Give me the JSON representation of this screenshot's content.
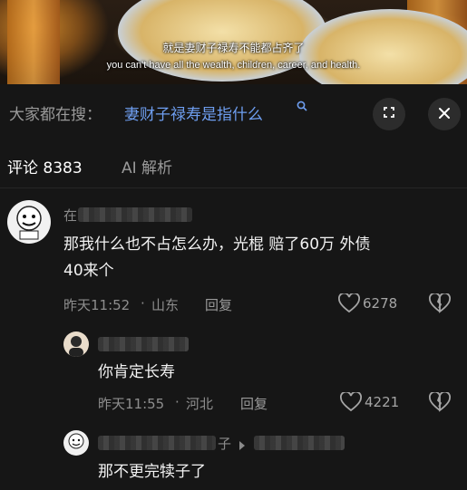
{
  "video": {
    "subtitle_zh": "就是妻财子禄寿不能都占齐了",
    "subtitle_en": "you can't have all the wealth, children, career, and health."
  },
  "search": {
    "prefix": "大家都在搜：",
    "query": "妻财子禄寿是指什么",
    "icon": "search-icon"
  },
  "actions": {
    "expand_icon": "expand-icon",
    "close_icon": "close-icon"
  },
  "tabs": [
    {
      "label": "评论 8383",
      "active": true
    },
    {
      "label": "AI 解析",
      "active": false
    }
  ],
  "comments": [
    {
      "name_prefix": "在",
      "text_line1": "那我什么也不占怎么办，光棍 赔了60万 外债",
      "text_line2": "40来个",
      "time": "昨天11:52",
      "location": "山东",
      "reply_label": "回复",
      "likes": "6278"
    },
    {
      "text": "你肯定长寿",
      "time": "昨天11:55",
      "location": "河北",
      "reply_label": "回复",
      "likes": "4221"
    },
    {
      "name_suffix": "子",
      "text": "那不更完犊子了"
    }
  ]
}
